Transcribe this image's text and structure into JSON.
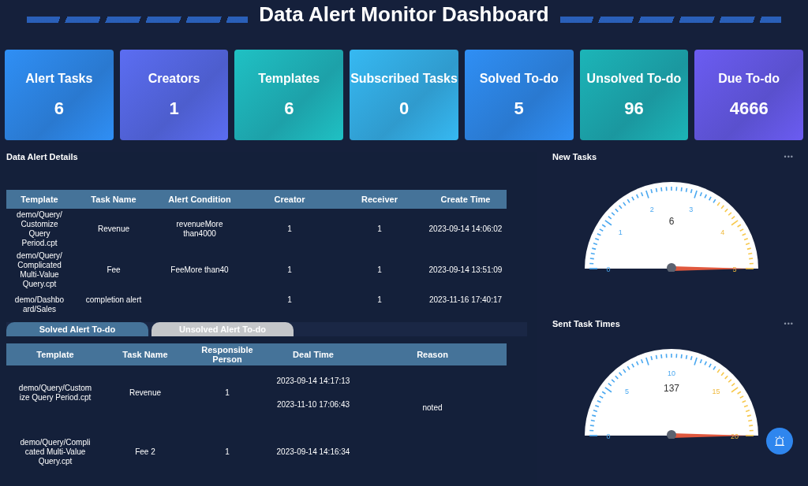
{
  "title": "Data Alert Monitor Dashboard",
  "cards": [
    {
      "label": "Alert Tasks",
      "value": "6",
      "color": "#2f8ff5"
    },
    {
      "label": "Creators",
      "value": "1",
      "color": "#5b6df2"
    },
    {
      "label": "Templates",
      "value": "6",
      "color": "#1fc1c4"
    },
    {
      "label": "Subscribed Tasks",
      "value": "0",
      "color": "#36b9f2"
    },
    {
      "label": "Solved To-do",
      "value": "5",
      "color": "#2f8ff5"
    },
    {
      "label": "Unsolved To-do",
      "value": "96",
      "color": "#1cb5b8"
    },
    {
      "label": "Due To-do",
      "value": "4666",
      "color": "#6b5cf2"
    }
  ],
  "details": {
    "title": "Data Alert Details",
    "columns": [
      "Template",
      "Task Name",
      "Alert Condition",
      "Creator",
      "Receiver",
      "Create Time"
    ],
    "rows": [
      [
        "demo/Query/ Customize Query Period.cpt",
        "Revenue",
        "revenueMore than4000",
        "1",
        "1",
        "2023-09-14 14:06:02"
      ],
      [
        "demo/Query/ Complicated Multi-Value Query.cpt",
        "Fee",
        "FeeMore than40",
        "1",
        "1",
        "2023-09-14 13:51:09"
      ],
      [
        "demo/Dashbo ard/Sales",
        "completion alert",
        "",
        "1",
        "1",
        "2023-11-16 17:40:17"
      ]
    ]
  },
  "todo_tabs": [
    {
      "label": "Solved Alert To-do",
      "selected": true
    },
    {
      "label": "Unsolved Alert To-do",
      "selected": false
    }
  ],
  "todo": {
    "columns": [
      "Template",
      "Task Name",
      "Responsible Person",
      "Deal Time",
      "Reason"
    ],
    "rows": [
      {
        "template": "demo/Query/Custom ize Query Period.cpt",
        "task": "Revenue",
        "person": "1",
        "times": [
          "2023-09-14 14:17:13",
          "2023-11-10 17:06:43"
        ],
        "reason": "noted"
      },
      {
        "template": "demo/Query/Compli cated Multi-Value Query.cpt",
        "task": "Fee 2",
        "person": "1",
        "times": [
          "2023-09-14 14:16:34"
        ],
        "reason": ""
      }
    ]
  },
  "gauges": [
    {
      "title": "New Tasks",
      "menu": "•••",
      "ticks": [
        "0",
        "1",
        "2",
        "3",
        "4",
        "5"
      ],
      "value": "6"
    },
    {
      "title": "Sent Task Times",
      "menu": "•••",
      "ticks": [
        "0",
        "5",
        "10",
        "15",
        "20"
      ],
      "value": "137"
    }
  ]
}
